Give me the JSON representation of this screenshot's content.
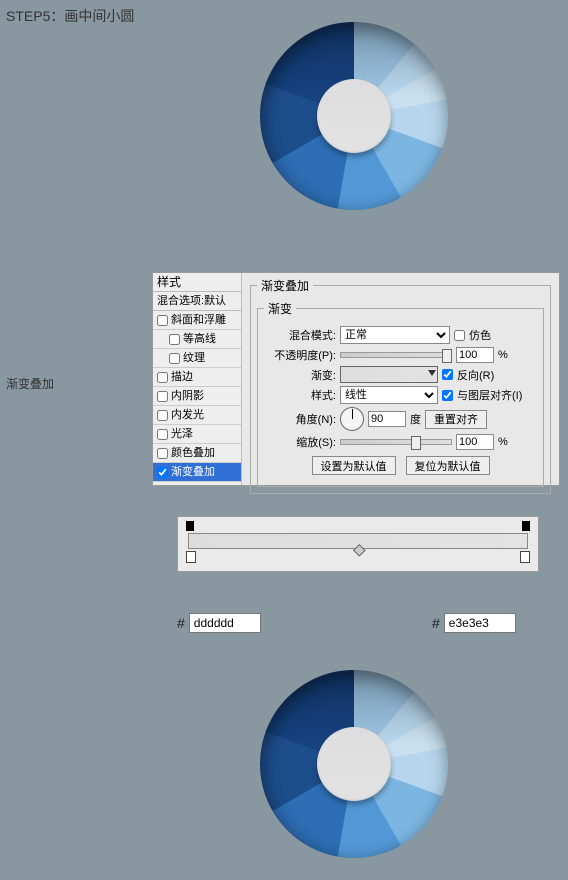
{
  "title": "STEP5：画中间小圆",
  "side_label": "渐变叠加",
  "styles_panel": {
    "header": "样式",
    "sub": "混合选项:默认",
    "items": [
      {
        "label": "斜面和浮雕",
        "checked": false
      },
      {
        "label": "等高线",
        "checked": false,
        "indented": true
      },
      {
        "label": "纹理",
        "checked": false,
        "indented": true
      },
      {
        "label": "描边",
        "checked": false
      },
      {
        "label": "内阴影",
        "checked": false
      },
      {
        "label": "内发光",
        "checked": false
      },
      {
        "label": "光泽",
        "checked": false
      },
      {
        "label": "颜色叠加",
        "checked": false
      },
      {
        "label": "渐变叠加",
        "checked": true,
        "selected": true
      }
    ]
  },
  "options": {
    "title_big": "渐变叠加",
    "title_inner": "渐变",
    "blend_mode_label": "混合模式:",
    "blend_mode_value": "正常",
    "dither_label": "仿色",
    "opacity_label": "不透明度(P):",
    "opacity_value": "100",
    "opacity_unit": "%",
    "gradient_label": "渐变:",
    "reverse_label": "反向(R)",
    "style_label": "样式:",
    "style_value": "线性",
    "align_label": "与图层对齐(I)",
    "angle_label": "角度(N):",
    "angle_value": "90",
    "angle_unit": "度",
    "reset_align": "重置对齐",
    "scale_label": "缩放(S):",
    "scale_value": "100",
    "scale_unit": "%",
    "set_default": "设置为默认值",
    "reset_default": "复位为默认值"
  },
  "colors": {
    "c1": "dddddd",
    "c2": "e3e3e3"
  }
}
